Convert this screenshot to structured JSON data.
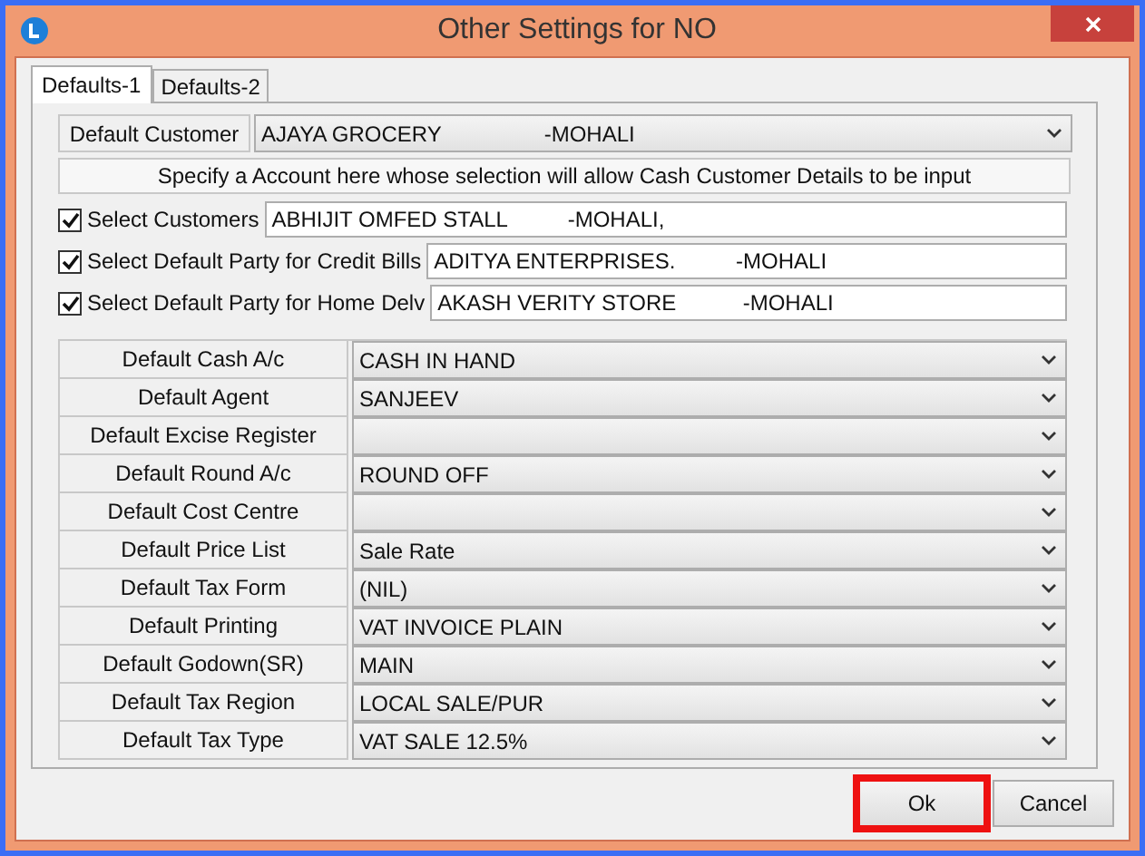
{
  "window": {
    "title": "Other Settings for NO"
  },
  "tabs": [
    {
      "label": "Defaults-1",
      "selected": true
    },
    {
      "label": "Defaults-2",
      "selected": false
    }
  ],
  "default_customer": {
    "label": "Default Customer",
    "value": "AJAYA GROCERY                 -MOHALI"
  },
  "info": "Specify a Account here whose selection will allow Cash Customer Details to be input",
  "checks": [
    {
      "label": "Select Customers",
      "checked": true,
      "value": "ABHIJIT OMFED STALL          -MOHALI,"
    },
    {
      "label": "Select Default Party for Credit Bills",
      "checked": true,
      "value": "ADITYA ENTERPRISES.          -MOHALI"
    },
    {
      "label": "Select Default Party for Home Delv",
      "checked": true,
      "value": "AKASH VERITY STORE           -MOHALI"
    }
  ],
  "settings": [
    {
      "label": "Default Cash A/c",
      "value": "CASH IN HAND"
    },
    {
      "label": "Default Agent",
      "value": "SANJEEV"
    },
    {
      "label": "Default Excise Register"
    },
    {
      "label": "Default Round A/c",
      "value": "ROUND OFF"
    },
    {
      "label": "Default Cost Centre"
    },
    {
      "label": "Default Price List",
      "value": "Sale Rate"
    },
    {
      "label": "Default Tax Form",
      "value": "(NIL)"
    },
    {
      "label": "Default Printing",
      "value": "VAT INVOICE PLAIN"
    },
    {
      "label": "Default Godown(SR)",
      "value": "MAIN"
    },
    {
      "label": "Default Tax Region",
      "value": "LOCAL SALE/PUR"
    },
    {
      "label": "Default Tax Type",
      "value": "VAT SALE 12.5%"
    }
  ],
  "buttons": [
    {
      "label": "Ok",
      "highlighted": true
    },
    {
      "label": "Cancel",
      "highlighted": false
    }
  ]
}
